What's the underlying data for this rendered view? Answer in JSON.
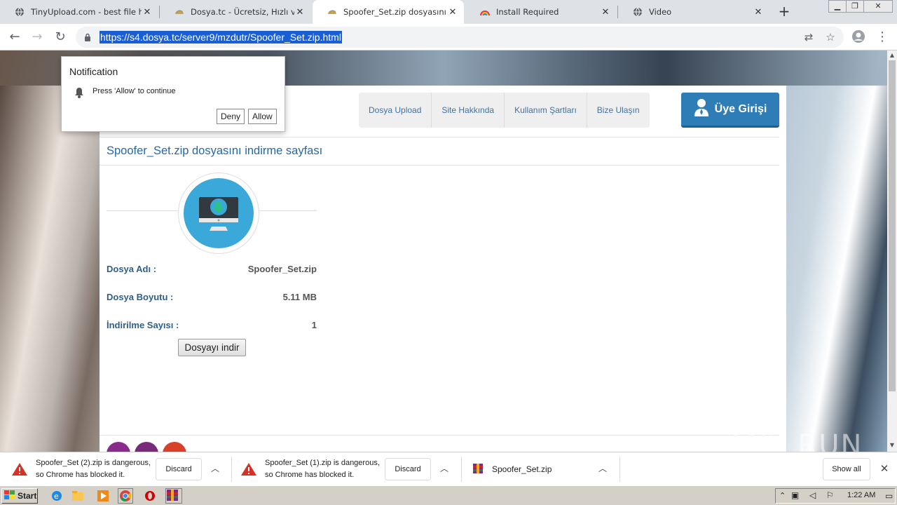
{
  "tabs": [
    {
      "title": "TinyUpload.com - best file hosting",
      "icon": "globe-icon"
    },
    {
      "title": "Dosya.tc - Ücretsiz, Hızlı ve Kolay",
      "icon": "dosya-icon"
    },
    {
      "title": "Spoofer_Set.zip dosyasını indirme",
      "icon": "dosya-icon"
    },
    {
      "title": "Install Required",
      "icon": "rainbow-icon"
    },
    {
      "title": "Video",
      "icon": "globe-icon"
    }
  ],
  "active_tab_index": 2,
  "address_bar": {
    "url": "https://s4.dosya.tc/server9/mzdutr/Spoofer_Set.zip.html"
  },
  "notification": {
    "title": "Notification",
    "message": "Press 'Allow' to continue",
    "deny_label": "Deny",
    "allow_label": "Allow"
  },
  "site": {
    "nav": [
      "Dosya Upload",
      "Site Hakkında",
      "Kullanım Şartları",
      "Bize Ulaşın"
    ],
    "login_label": "Üye Girişi",
    "page_title": "Spoofer_Set.zip dosyasını indirme sayfası",
    "file_info": [
      {
        "key": "Dosya Adı :",
        "value": "Spoofer_Set.zip"
      },
      {
        "key": "Dosya Boyutu :",
        "value": "5.11 MB"
      },
      {
        "key": "İndirilme Sayısı :",
        "value": "1"
      }
    ],
    "download_button": "Dosyayı indir"
  },
  "downloads": [
    {
      "line1": "Spoofer_Set (2).zip is dangerous,",
      "line2": "so Chrome has blocked it.",
      "action": "Discard",
      "icon": "warning-icon"
    },
    {
      "line1": "Spoofer_Set (1).zip is dangerous,",
      "line2": "so Chrome has blocked it.",
      "action": "Discard",
      "icon": "warning-icon"
    },
    {
      "filename": "Spoofer_Set.zip",
      "icon": "winrar-icon"
    }
  ],
  "show_all_label": "Show all",
  "taskbar": {
    "start_label": "Start",
    "clock": "1:22 AM"
  },
  "watermark": "ANY RUN",
  "colors": {
    "accent": "#2f7db6",
    "title": "#2568a8",
    "selection": "#1a5ed6",
    "download_circle": "#3aa8d8"
  }
}
